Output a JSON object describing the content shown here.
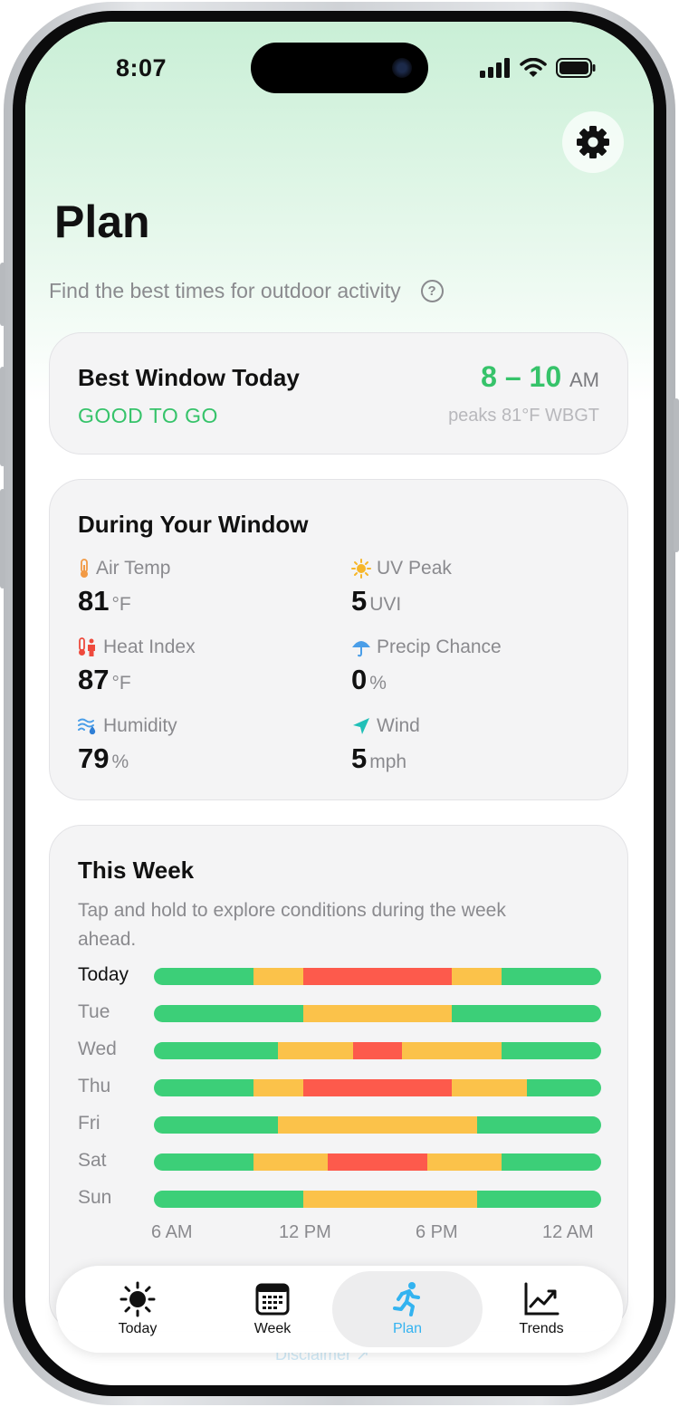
{
  "status": {
    "time": "8:07"
  },
  "header": {
    "title": "Plan",
    "subtitle": "Find the best times for outdoor activity",
    "help_icon": "question-circle-icon",
    "settings_icon": "gear-icon"
  },
  "best_window": {
    "title": "Best Window Today",
    "status": "GOOD TO GO",
    "time_range": "8 – 10",
    "time_suffix": "AM",
    "peaks": "peaks 81°F WBGT",
    "accent_color": "#36c36a"
  },
  "during_window": {
    "title": "During Your Window",
    "metrics": [
      {
        "icon": "thermometer-icon",
        "label": "Air Temp",
        "value": "81",
        "unit": "°F"
      },
      {
        "icon": "sun-icon",
        "label": "UV Peak",
        "value": "5",
        "unit": "UVI"
      },
      {
        "icon": "heat-index-icon",
        "label": "Heat Index",
        "value": "87",
        "unit": "°F"
      },
      {
        "icon": "umbrella-icon",
        "label": "Precip Chance",
        "value": "0",
        "unit": "%"
      },
      {
        "icon": "humidity-icon",
        "label": "Humidity",
        "value": "79",
        "unit": "%"
      },
      {
        "icon": "wind-icon",
        "label": "Wind",
        "value": "5",
        "unit": "mph"
      }
    ]
  },
  "this_week": {
    "title": "This Week",
    "description": "Tap and hold to explore conditions during the week ahead.",
    "colors": {
      "green": "#3ccf78",
      "yellow": "#fbc24a",
      "red": "#fd5a4c"
    },
    "days": [
      {
        "label": "Today",
        "segments": [
          [
            "green",
            4
          ],
          [
            "yellow",
            2
          ],
          [
            "red",
            6
          ],
          [
            "yellow",
            2
          ],
          [
            "green",
            4
          ]
        ]
      },
      {
        "label": "Tue",
        "segments": [
          [
            "green",
            6
          ],
          [
            "yellow",
            6
          ],
          [
            "green",
            6
          ]
        ]
      },
      {
        "label": "Wed",
        "segments": [
          [
            "green",
            5
          ],
          [
            "yellow",
            3
          ],
          [
            "red",
            2
          ],
          [
            "yellow",
            4
          ],
          [
            "green",
            4
          ]
        ]
      },
      {
        "label": "Thu",
        "segments": [
          [
            "green",
            4
          ],
          [
            "yellow",
            2
          ],
          [
            "red",
            6
          ],
          [
            "yellow",
            3
          ],
          [
            "green",
            3
          ]
        ]
      },
      {
        "label": "Fri",
        "segments": [
          [
            "green",
            5
          ],
          [
            "yellow",
            8
          ],
          [
            "green",
            5
          ]
        ]
      },
      {
        "label": "Sat",
        "segments": [
          [
            "green",
            4
          ],
          [
            "yellow",
            3
          ],
          [
            "red",
            4
          ],
          [
            "yellow",
            3
          ],
          [
            "green",
            4
          ]
        ]
      },
      {
        "label": "Sun",
        "segments": [
          [
            "green",
            6
          ],
          [
            "yellow",
            7
          ],
          [
            "green",
            5
          ]
        ]
      }
    ],
    "axis_labels": [
      "6 AM",
      "12 PM",
      "6 PM",
      "12 AM"
    ]
  },
  "tabs": [
    {
      "label": "Today",
      "icon": "sun-icon",
      "active": false
    },
    {
      "label": "Week",
      "icon": "calendar-icon",
      "active": false
    },
    {
      "label": "Plan",
      "icon": "runner-icon",
      "active": true
    },
    {
      "label": "Trends",
      "icon": "trend-chart-icon",
      "active": false
    }
  ],
  "footer": {
    "disclaimer": "Disclaimer ↗"
  }
}
